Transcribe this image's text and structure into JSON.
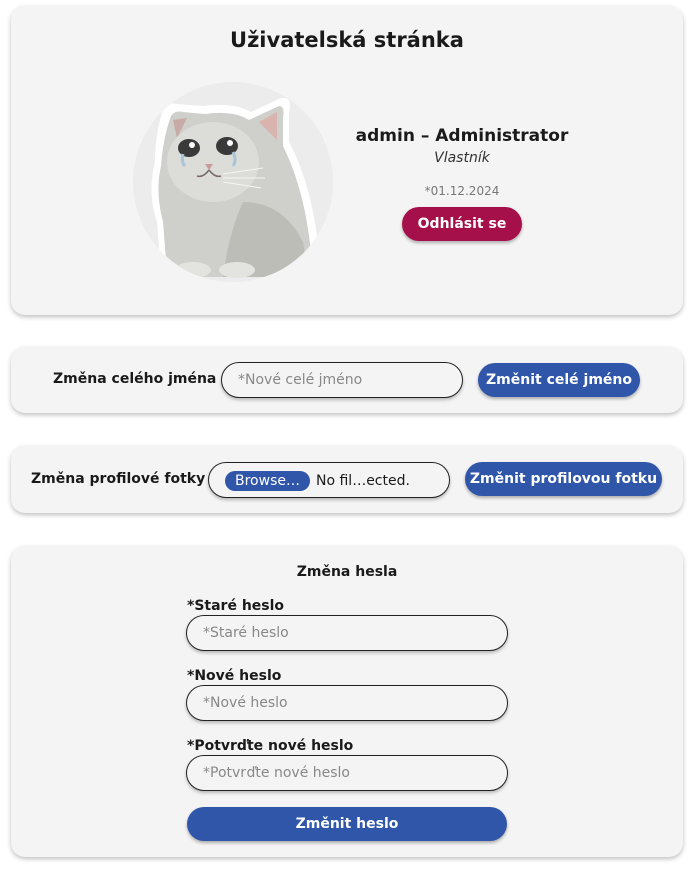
{
  "profile": {
    "title": "Uživatelská stránka",
    "username": "admin – Administrator",
    "role": "Vlastník",
    "joined": "*01.12.2024",
    "logout_label": "Odhlásit se"
  },
  "name_change": {
    "label": "Změna celého jména",
    "placeholder": "*Nové celé jméno",
    "button_label": "Změnit celé jméno"
  },
  "photo_change": {
    "label": "Změna profilové fotky",
    "browse_label": "Browse…",
    "file_status": "No fil…ected.",
    "button_label": "Změnit profilovou fotku"
  },
  "password_change": {
    "title": "Změna hesla",
    "fields": [
      {
        "label": "*Staré heslo",
        "placeholder": "*Staré heslo"
      },
      {
        "label": "*Nové heslo",
        "placeholder": "*Nové heslo"
      },
      {
        "label": "*Potvrďte nové heslo",
        "placeholder": "*Potvrďte nové heslo"
      }
    ],
    "button_label": "Změnit heslo"
  },
  "colors": {
    "card_bg": "#f4f4f4",
    "primary_blue": "#2f56a9",
    "logout_red": "#a5104a"
  }
}
